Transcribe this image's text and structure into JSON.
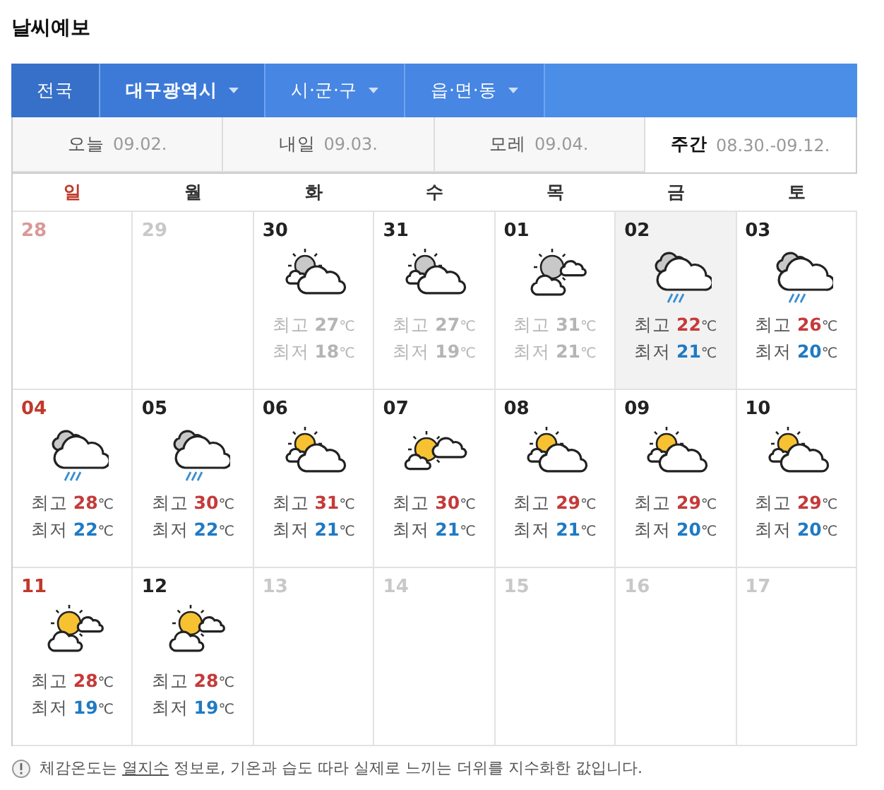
{
  "title": "날씨예보",
  "breadcrumb": [
    {
      "label": "전국",
      "dropdown": false,
      "selected": false
    },
    {
      "label": "대구광역시",
      "dropdown": true,
      "selected": true
    },
    {
      "label": "시·군·구",
      "dropdown": true,
      "selected": false
    },
    {
      "label": "읍·면·동",
      "dropdown": true,
      "selected": false
    }
  ],
  "tabs": [
    {
      "label": "오늘",
      "date": "09.02.",
      "selected": false
    },
    {
      "label": "내일",
      "date": "09.03.",
      "selected": false
    },
    {
      "label": "모레",
      "date": "09.04.",
      "selected": false
    },
    {
      "label": "주간",
      "date": "08.30.-09.12.",
      "selected": true
    }
  ],
  "weekdays": [
    "일",
    "월",
    "화",
    "수",
    "목",
    "금",
    "토"
  ],
  "weeks": [
    [
      {
        "date": "28",
        "faded": true,
        "selected": false
      },
      {
        "date": "29",
        "faded": true,
        "selected": false
      },
      {
        "date": "30",
        "faded": true,
        "selected": false,
        "kind": "cloudy_sun",
        "temps": [
          {
            "label": "최고",
            "value": "27",
            "unit": "℃"
          },
          {
            "label": "최저",
            "value": "18",
            "unit": "℃"
          }
        ]
      },
      {
        "date": "31",
        "faded": true,
        "selected": false,
        "kind": "cloudy_sun",
        "temps": [
          {
            "label": "최고",
            "value": "27",
            "unit": "℃"
          },
          {
            "label": "최저",
            "value": "19",
            "unit": "℃"
          }
        ]
      },
      {
        "date": "01",
        "faded": true,
        "selected": false,
        "kind": "sun_two_clouds",
        "temps": [
          {
            "label": "최고",
            "value": "31",
            "unit": "℃"
          },
          {
            "label": "최저",
            "value": "21",
            "unit": "℃"
          }
        ]
      },
      {
        "date": "02",
        "faded": false,
        "selected": true,
        "kind": "rain",
        "temps": [
          {
            "label": "최고",
            "value": "22",
            "unit": "℃"
          },
          {
            "label": "최저",
            "value": "21",
            "unit": "℃"
          }
        ]
      },
      {
        "date": "03",
        "faded": false,
        "selected": false,
        "kind": "rain",
        "temps": [
          {
            "label": "최고",
            "value": "26",
            "unit": "℃"
          },
          {
            "label": "최저",
            "value": "20",
            "unit": "℃"
          }
        ]
      }
    ],
    [
      {
        "date": "04",
        "faded": false,
        "selected": false,
        "kind": "rain",
        "temps": [
          {
            "label": "최고",
            "value": "28",
            "unit": "℃"
          },
          {
            "label": "최저",
            "value": "22",
            "unit": "℃"
          }
        ]
      },
      {
        "date": "05",
        "faded": false,
        "selected": false,
        "kind": "rain",
        "temps": [
          {
            "label": "최고",
            "value": "30",
            "unit": "℃"
          },
          {
            "label": "최저",
            "value": "22",
            "unit": "℃"
          }
        ]
      },
      {
        "date": "06",
        "faded": false,
        "selected": false,
        "kind": "cloudy_sun",
        "temps": [
          {
            "label": "최고",
            "value": "31",
            "unit": "℃"
          },
          {
            "label": "최저",
            "value": "21",
            "unit": "℃"
          }
        ]
      },
      {
        "date": "07",
        "faded": false,
        "selected": false,
        "kind": "sun_side_cloud",
        "temps": [
          {
            "label": "최고",
            "value": "30",
            "unit": "℃"
          },
          {
            "label": "최저",
            "value": "21",
            "unit": "℃"
          }
        ]
      },
      {
        "date": "08",
        "faded": false,
        "selected": false,
        "kind": "cloudy_sun",
        "temps": [
          {
            "label": "최고",
            "value": "29",
            "unit": "℃"
          },
          {
            "label": "최저",
            "value": "21",
            "unit": "℃"
          }
        ]
      },
      {
        "date": "09",
        "faded": false,
        "selected": false,
        "kind": "cloudy_sun",
        "temps": [
          {
            "label": "최고",
            "value": "29",
            "unit": "℃"
          },
          {
            "label": "최저",
            "value": "20",
            "unit": "℃"
          }
        ]
      },
      {
        "date": "10",
        "faded": false,
        "selected": false,
        "kind": "cloudy_sun",
        "temps": [
          {
            "label": "최고",
            "value": "29",
            "unit": "℃"
          },
          {
            "label": "최저",
            "value": "20",
            "unit": "℃"
          }
        ]
      }
    ],
    [
      {
        "date": "11",
        "faded": false,
        "selected": false,
        "kind": "sun_two_clouds",
        "temps": [
          {
            "label": "최고",
            "value": "28",
            "unit": "℃"
          },
          {
            "label": "최저",
            "value": "19",
            "unit": "℃"
          }
        ]
      },
      {
        "date": "12",
        "faded": false,
        "selected": false,
        "kind": "sun_two_clouds",
        "temps": [
          {
            "label": "최고",
            "value": "28",
            "unit": "℃"
          },
          {
            "label": "최저",
            "value": "19",
            "unit": "℃"
          }
        ]
      },
      {
        "date": "13",
        "faded": true,
        "selected": false
      },
      {
        "date": "14",
        "faded": true,
        "selected": false
      },
      {
        "date": "15",
        "faded": true,
        "selected": false
      },
      {
        "date": "16",
        "faded": true,
        "selected": false
      },
      {
        "date": "17",
        "faded": true,
        "selected": false
      }
    ]
  ],
  "note": {
    "before": "체감온도는 ",
    "link": "열지수",
    "after": " 정보로, 기온과 습도 따라 실제로 느끼는 더위를 지수화한 값입니다."
  }
}
